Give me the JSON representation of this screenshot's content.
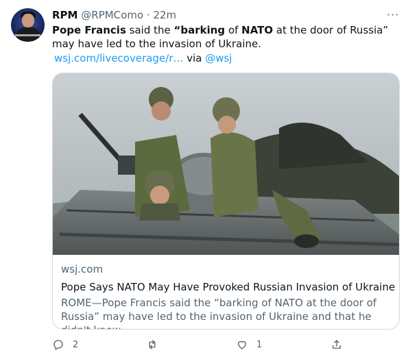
{
  "tweet": {
    "display_name": "RPM",
    "handle": "@RPMComo",
    "separator": "·",
    "time": "22m",
    "more": "···",
    "text": {
      "part1": "Pope Francis",
      "part2": " said the ",
      "part3": "“barking",
      "part4": " of ",
      "part5": "NATO",
      "part6": " at the door of Russia” may have led to the invasion of Ukraine."
    },
    "link_text": "wsj.com/livecoverage/r…",
    "via_label": " via ",
    "via_handle": "@wsj"
  },
  "card": {
    "domain": "wsj.com",
    "title": "Pope Says NATO May Have Provoked Russian Invasion of Ukraine",
    "description": "ROME—Pope Francis said the “barking of NATO at the door of Russia” may have led to the invasion of Ukraine and that he didn't know …"
  },
  "actions": {
    "reply_count": "2",
    "retweet_count": "",
    "like_count": "1",
    "icons": [
      "reply-icon",
      "retweet-icon",
      "like-icon",
      "share-icon"
    ]
  },
  "colors": {
    "text": "#0f1419",
    "secondary": "#536471",
    "link": "#1d9bf0",
    "border": "#cfd9de"
  }
}
